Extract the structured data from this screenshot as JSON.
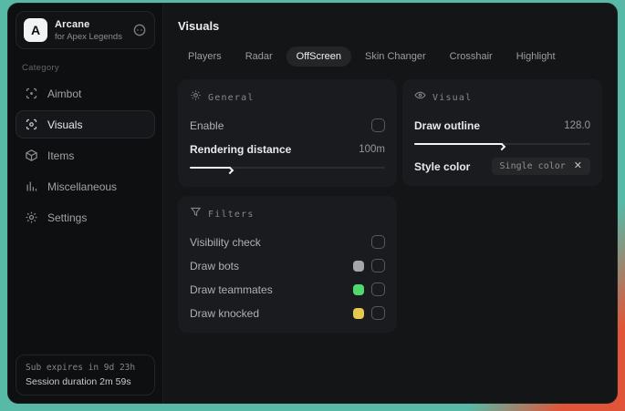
{
  "colors": {
    "desktop_teal": "#57b9a6",
    "desktop_red": "#e0553a",
    "accent_white": "#f2f3f4"
  },
  "window": {
    "brand": {
      "logo_letter": "A",
      "title": "Arcane",
      "subtitle": "for Apex Legends"
    },
    "sidebar": {
      "category_label": "Category",
      "items": [
        {
          "label": "Aimbot",
          "icon": "crosshair-icon",
          "selected": false
        },
        {
          "label": "Visuals",
          "icon": "eye-scan-icon",
          "selected": true
        },
        {
          "label": "Items",
          "icon": "box-icon",
          "selected": false
        },
        {
          "label": "Miscellaneous",
          "icon": "bars-icon",
          "selected": false
        },
        {
          "label": "Settings",
          "icon": "gear-icon",
          "selected": false
        }
      ],
      "status": {
        "sub_expires": "Sub expires in 9d 23h",
        "session_duration": "Session duration 2m 59s"
      }
    },
    "main": {
      "title": "Visuals",
      "tabs": [
        {
          "label": "Players",
          "selected": false
        },
        {
          "label": "Radar",
          "selected": false
        },
        {
          "label": "OffScreen",
          "selected": true
        },
        {
          "label": "Skin Changer",
          "selected": false
        },
        {
          "label": "Crosshair",
          "selected": false
        },
        {
          "label": "Highlight",
          "selected": false
        }
      ],
      "panels": {
        "general": {
          "title": "General",
          "icon": "sun-icon",
          "enable_label": "Enable",
          "enable_checked": false,
          "rendering_distance_label": "Rendering distance",
          "rendering_distance_value": "100m",
          "rendering_distance_percent": 21
        },
        "visual": {
          "title": "Visual",
          "icon": "eye-icon",
          "draw_outline_label": "Draw outline",
          "draw_outline_value": "128.0",
          "draw_outline_percent": 50,
          "style_color_label": "Style color",
          "style_color_value": "Single color"
        },
        "filters": {
          "title": "Filters",
          "icon": "filter-icon",
          "rows": [
            {
              "label": "Visibility check",
              "swatch": null,
              "checked": false
            },
            {
              "label": "Draw bots",
              "swatch": "#a3a7aa",
              "checked": false
            },
            {
              "label": "Draw teammates",
              "swatch": "#4fd86b",
              "checked": false
            },
            {
              "label": "Draw knocked",
              "swatch": "#e5c84f",
              "checked": false
            }
          ]
        }
      }
    }
  }
}
